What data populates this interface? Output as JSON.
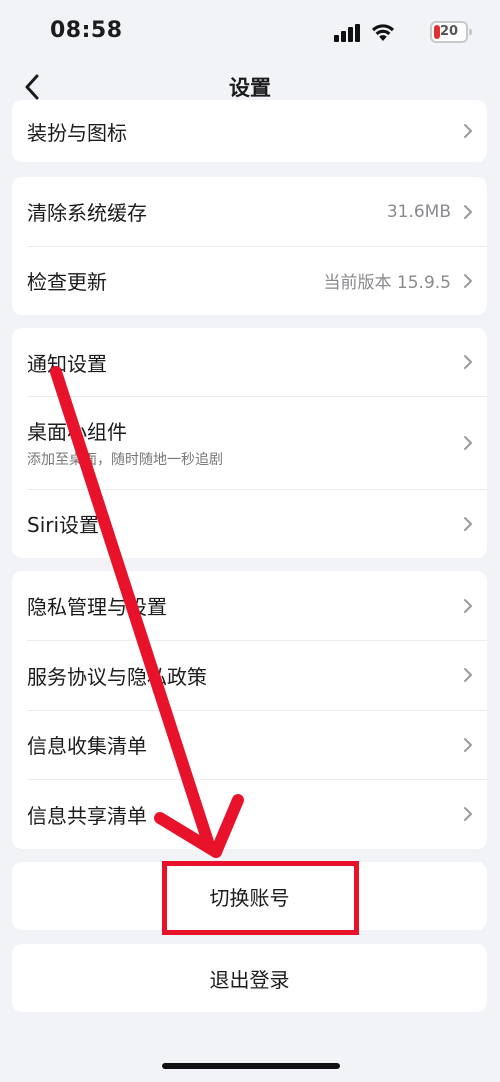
{
  "status_bar": {
    "time": "08:58",
    "battery_level": "20",
    "battery_color": "#e0312e"
  },
  "nav": {
    "title": "设置",
    "back_icon": "chevron-left-icon"
  },
  "groups": [
    {
      "items": [
        {
          "label": "装扮与图标"
        }
      ]
    },
    {
      "items": [
        {
          "label": "清除系统缓存",
          "value": "31.6MB"
        },
        {
          "label": "检查更新",
          "value": "当前版本 15.9.5"
        }
      ]
    },
    {
      "items": [
        {
          "label": "通知设置"
        },
        {
          "label": "桌面小组件",
          "subtitle": "添加至桌面，随时随地一秒追剧"
        },
        {
          "label": "Siri设置"
        }
      ]
    },
    {
      "items": [
        {
          "label": "隐私管理与设置"
        },
        {
          "label": "服务协议与隐私政策"
        },
        {
          "label": "信息收集清单"
        },
        {
          "label": "信息共享清单"
        }
      ]
    }
  ],
  "actions": {
    "switch_account": "切换账号",
    "logout": "退出登录"
  },
  "annotation": {
    "color": "#e8132a",
    "arrow_icon": "arrow-down-icon"
  }
}
